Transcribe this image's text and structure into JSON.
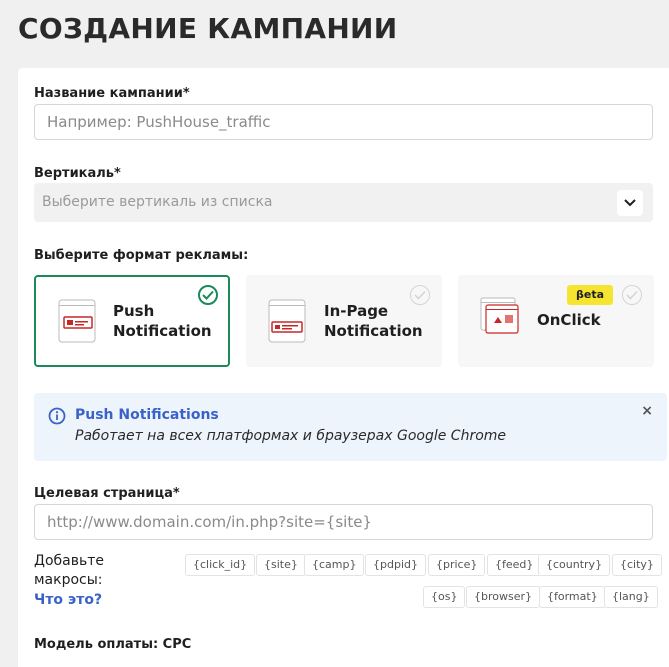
{
  "page": {
    "title": "СОЗДАНИЕ КАМПАНИИ"
  },
  "campaign_name": {
    "label": "Название кампании*",
    "placeholder": "Например: PushHouse_traffic"
  },
  "vertical": {
    "label": "Вертикаль*",
    "placeholder": "Выберите вертикаль из списка",
    "icon": "chevron-down-icon"
  },
  "format": {
    "label": "Выберите формат рекламы:",
    "options": [
      {
        "line1": "Push",
        "line2": "Notification",
        "selected": true
      },
      {
        "line1": "In-Page",
        "line2": "Notification",
        "selected": false
      },
      {
        "line1": "OnClick",
        "line2": "",
        "badge": "βeta",
        "selected": false
      }
    ]
  },
  "info": {
    "title": "Push Notifications",
    "text": "Работает на всех платформах и браузерах Google Chrome",
    "close": "×"
  },
  "target_page": {
    "label": "Целевая страница*",
    "placeholder": "http://www.domain.com/in.php?site={site}"
  },
  "macros": {
    "label_line1": "Добавьте",
    "label_line2": "макросы:",
    "link": "Что это?",
    "row1": [
      "{click_id}",
      "{site}",
      "{camp}",
      "{pdpid}",
      "{price}",
      "{feed}",
      "{country}",
      "{city}"
    ],
    "row2": [
      "{os}",
      "{browser}",
      "{format}",
      "{lang}"
    ]
  },
  "payment": {
    "label": "Модель оплаты: CPC"
  },
  "colors": {
    "accent_green": "#1a8a5a",
    "link_blue": "#3a63c9",
    "beta_yellow": "#f5e430"
  }
}
